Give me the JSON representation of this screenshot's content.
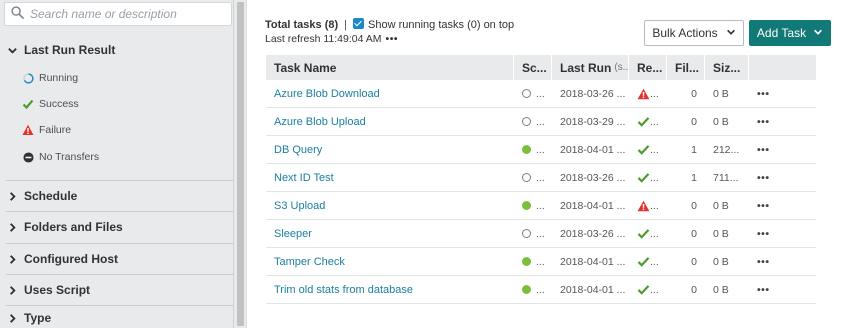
{
  "search": {
    "placeholder": "Search name or description"
  },
  "sidebar": {
    "last_run": {
      "label": "Last Run Result",
      "filters": [
        {
          "label": "Running",
          "icon": "spinner-icon"
        },
        {
          "label": "Success",
          "icon": "check-icon",
          "color": "#4d9d2c"
        },
        {
          "label": "Failure",
          "icon": "warning-icon",
          "color": "#e5312d"
        },
        {
          "label": "No Transfers",
          "icon": "minus-circle-icon",
          "color": "#333333"
        }
      ]
    },
    "sections": [
      "Schedule",
      "Folders and Files",
      "Configured Host",
      "Uses Script",
      "Type"
    ]
  },
  "summary": {
    "total": "Total tasks (8)",
    "separator": "|",
    "show_running": "Show running tasks (0) on top",
    "refresh": "Last refresh 11:49:04 AM",
    "more": "•••"
  },
  "buttons": {
    "bulk": "Bulk Actions",
    "add": "Add Task"
  },
  "colors": {
    "accent": "#127a76",
    "link": "#1b7f9f",
    "checkbox": "#1a88c9"
  },
  "table": {
    "headers": {
      "name": "Task Name",
      "schedule": "Sc...",
      "last_run": "Last Run",
      "last_run_hint": "(s...",
      "result": "Re...",
      "files": "Fil...",
      "size": "Siz..."
    },
    "rows": [
      {
        "name": "Azure Blob Download",
        "schedule": "...",
        "sched_state": "idle",
        "last_run": "2018-03-26 ...",
        "result": "...",
        "result_icon": "warning",
        "files": "0",
        "size": "0 B",
        "more": "•••"
      },
      {
        "name": "Azure Blob Upload",
        "schedule": "...",
        "sched_state": "idle",
        "last_run": "2018-03-29 ...",
        "result": "...",
        "result_icon": "check",
        "files": "0",
        "size": "0 B",
        "more": "•••"
      },
      {
        "name": "DB Query",
        "schedule": "...",
        "sched_state": "active",
        "last_run": "2018-04-01 ...",
        "result": "...",
        "result_icon": "check",
        "files": "1",
        "size": "212...",
        "more": "•••"
      },
      {
        "name": "Next ID Test",
        "schedule": "...",
        "sched_state": "idle",
        "last_run": "2018-03-26 ...",
        "result": "...",
        "result_icon": "check",
        "files": "1",
        "size": "711...",
        "more": "•••"
      },
      {
        "name": "S3 Upload",
        "schedule": "...",
        "sched_state": "active",
        "last_run": "2018-04-01 ...",
        "result": "...",
        "result_icon": "warning",
        "files": "0",
        "size": "0 B",
        "more": "•••"
      },
      {
        "name": "Sleeper",
        "schedule": "...",
        "sched_state": "idle",
        "last_run": "2018-03-26 ...",
        "result": "...",
        "result_icon": "check",
        "files": "0",
        "size": "0 B",
        "more": "•••"
      },
      {
        "name": "Tamper Check",
        "schedule": "...",
        "sched_state": "active",
        "last_run": "2018-04-01 ...",
        "result": "...",
        "result_icon": "check",
        "files": "0",
        "size": "0 B",
        "more": "•••"
      },
      {
        "name": "Trim old stats from database",
        "schedule": "...",
        "sched_state": "active",
        "last_run": "2018-04-01 ...",
        "result": "...",
        "result_icon": "check",
        "files": "0",
        "size": "0 B",
        "more": "•••"
      }
    ]
  }
}
